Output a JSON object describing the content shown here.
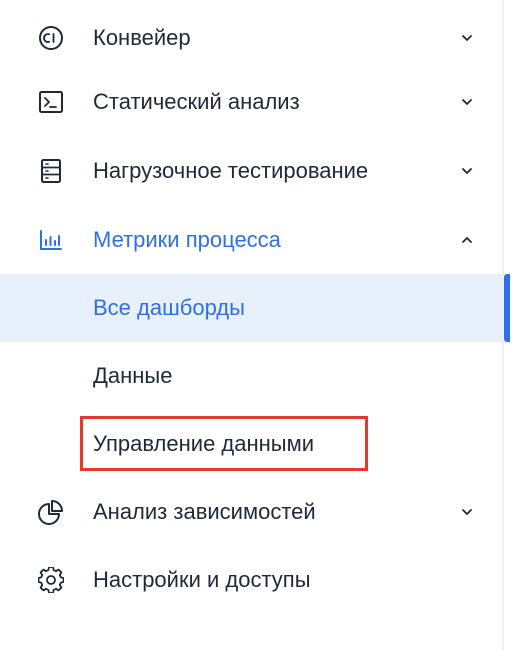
{
  "colors": {
    "accent": "#2f6fea",
    "text": "#1f2937",
    "selected_bg": "#e8f1fb",
    "annotation_red": "#e53a2b"
  },
  "menu": [
    {
      "id": "pipeline",
      "label": "Конвейер",
      "icon": "ci-circle-icon",
      "expanded": false
    },
    {
      "id": "static-analysis",
      "label": "Статический анализ",
      "icon": "terminal-icon",
      "expanded": false
    },
    {
      "id": "load-testing",
      "label": "Нагрузочное тестирование",
      "icon": "server-stack-icon",
      "expanded": false
    },
    {
      "id": "process-metrics",
      "label": "Метрики процесса",
      "icon": "bar-chart-icon",
      "expanded": true,
      "children": [
        {
          "id": "all-dashboards",
          "label": "Все дашборды",
          "selected": true
        },
        {
          "id": "data",
          "label": "Данные",
          "selected": false
        },
        {
          "id": "data-management",
          "label": "Управление данными",
          "selected": false,
          "highlighted": true
        }
      ]
    },
    {
      "id": "dependency-analysis",
      "label": "Анализ зависимостей",
      "icon": "pie-chart-icon",
      "expanded": false
    },
    {
      "id": "settings-access",
      "label": "Настройки и доступы",
      "icon": "gear-icon",
      "expanded": null
    }
  ]
}
